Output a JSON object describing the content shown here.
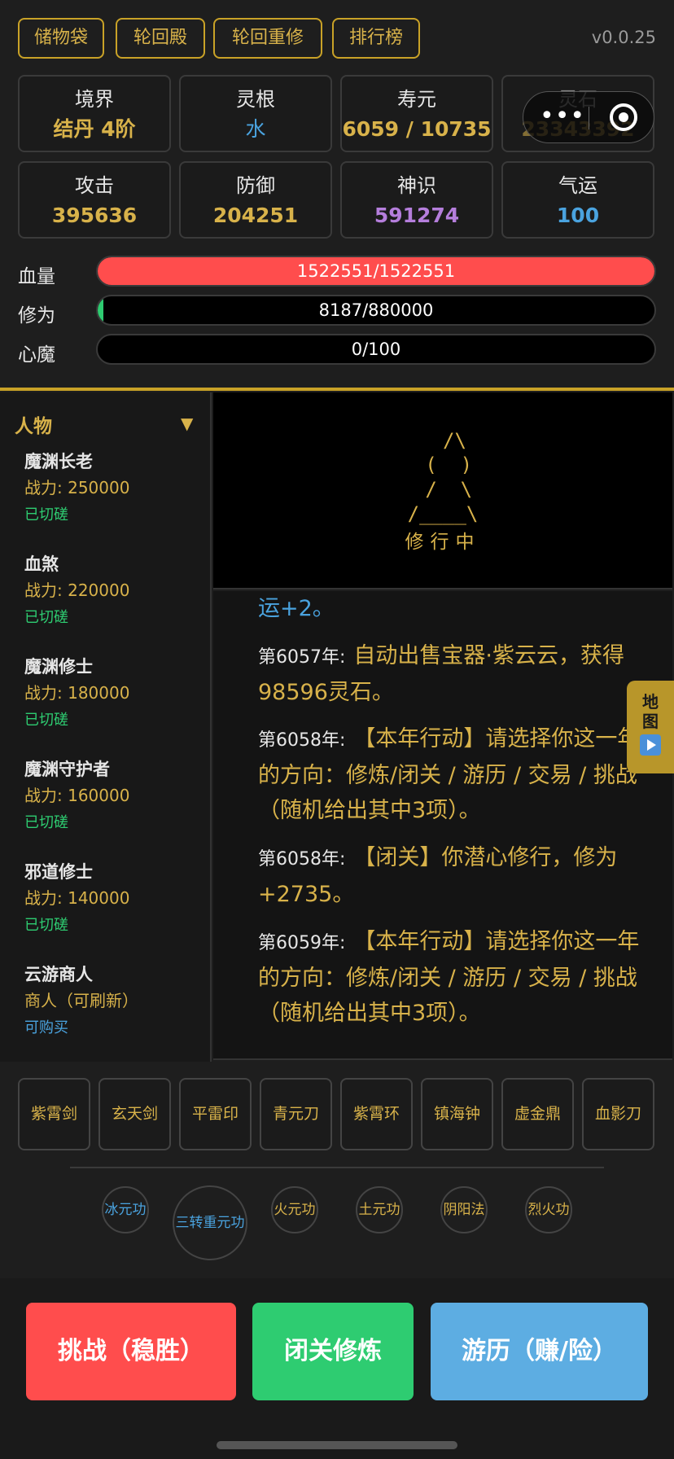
{
  "top_buttons": [
    "储物袋",
    "轮回殿",
    "轮回重修",
    "排行榜"
  ],
  "version": "v0.0.25",
  "stats": [
    {
      "label": "境界",
      "value": "结丹 4阶",
      "color": "#d8b24a"
    },
    {
      "label": "灵根",
      "value": "水",
      "color": "#4aa3df"
    },
    {
      "label": "寿元",
      "value": "6059 / 10735",
      "color": "#d8b24a"
    },
    {
      "label": "灵石",
      "value": "23343392",
      "color": "#d8b24a"
    },
    {
      "label": "攻击",
      "value": "395636",
      "color": "#d8b24a"
    },
    {
      "label": "防御",
      "value": "204251",
      "color": "#d8b24a"
    },
    {
      "label": "神识",
      "value": "591274",
      "color": "#b57edc"
    },
    {
      "label": "气运",
      "value": "100",
      "color": "#4aa3df"
    }
  ],
  "bars": [
    {
      "label": "血量",
      "text": "1522551/1522551",
      "fraction": 1.0,
      "color": "#ff4d4d"
    },
    {
      "label": "修为",
      "text": "8187/880000",
      "fraction": 0.0093,
      "color": "#2ecc71"
    },
    {
      "label": "心魔",
      "text": "0/100",
      "fraction": 0,
      "color": "#8e44ad"
    }
  ],
  "people": {
    "title": "人物",
    "list": [
      {
        "name": "魔渊长老",
        "power": "战力: 250000",
        "status": "已切磋"
      },
      {
        "name": "血煞",
        "power": "战力: 220000",
        "status": "已切磋"
      },
      {
        "name": "魔渊修士",
        "power": "战力: 180000",
        "status": "已切磋"
      },
      {
        "name": "魔渊守护者",
        "power": "战力: 160000",
        "status": "已切磋"
      },
      {
        "name": "邪道修士",
        "power": "战力: 140000",
        "status": "已切磋"
      },
      {
        "name": "云游商人",
        "power": "商人（可刷新）",
        "status": "可购买"
      }
    ]
  },
  "ascii": {
    "art": "  /\\\n (  )\n /  \\\n/____\\",
    "caption": "修行中"
  },
  "log": [
    {
      "year": "",
      "text": "运+2。"
    },
    {
      "year": "第6057年:",
      "text": "自动出售宝器·紫云云，获得98596灵石。"
    },
    {
      "year": "第6058年:",
      "text": "【本年行动】请选择你这一年的方向：修炼/闭关 / 游历 / 交易 / 挑战（随机给出其中3项）。"
    },
    {
      "year": "第6058年:",
      "text": "【闭关】你潜心修行，修为+2735。"
    },
    {
      "year": "第6059年:",
      "text": "【本年行动】请选择你这一年的方向：修炼/闭关 / 游历 / 交易 / 挑战（随机给出其中3项）。"
    }
  ],
  "map_tab": "地图",
  "treasures": [
    "紫霄剑",
    "玄天剑",
    "平雷印",
    "青元刀",
    "紫霄环",
    "镇海钟",
    "虚金鼎",
    "血影刀"
  ],
  "skills": [
    {
      "name": "冰元功",
      "color": "#4aa3df"
    },
    {
      "name": "三转重元功",
      "color": "#4aa3df"
    },
    {
      "name": "火元功",
      "color": "#d8b24a"
    },
    {
      "name": "土元功",
      "color": "#d8b24a"
    },
    {
      "name": "阴阳法",
      "color": "#d8b24a"
    },
    {
      "name": "烈火功",
      "color": "#d8b24a"
    }
  ],
  "actions": [
    {
      "label": "挑战（稳胜）",
      "color": "#ff4d4d"
    },
    {
      "label": "闭关修炼",
      "color": "#2ecc71"
    },
    {
      "label": "游历（赚/险）",
      "color": "#5dade2"
    }
  ]
}
